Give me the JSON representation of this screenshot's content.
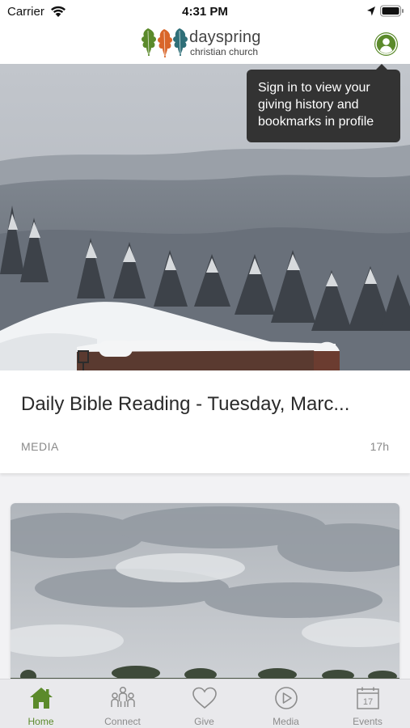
{
  "status_bar": {
    "carrier": "Carrier",
    "time": "4:31 PM"
  },
  "header": {
    "logo_name": "dayspring",
    "logo_subtitle": "christian church",
    "profile_icon": "user-icon"
  },
  "tooltip": {
    "text": "Sign in to view your giving history and bookmarks in profile"
  },
  "feed": {
    "cards": [
      {
        "title": "Daily Bible Reading - Tuesday, Marc...",
        "category": "MEDIA",
        "time_ago": "17h"
      }
    ]
  },
  "tab_bar": {
    "tabs": [
      {
        "label": "Home",
        "icon": "home-icon",
        "active": true
      },
      {
        "label": "Connect",
        "icon": "people-icon",
        "active": false
      },
      {
        "label": "Give",
        "icon": "heart-icon",
        "active": false
      },
      {
        "label": "Media",
        "icon": "play-icon",
        "active": false
      },
      {
        "label": "Events",
        "icon": "calendar-icon",
        "active": false
      }
    ],
    "events_date": "17"
  },
  "colors": {
    "brand_green": "#5b8a2b",
    "tooltip_bg": "#333333",
    "inactive_tab": "#8c8c8c",
    "leaf_green": "#5b8a2b",
    "leaf_orange": "#d9662a",
    "leaf_teal": "#2f6f78"
  }
}
